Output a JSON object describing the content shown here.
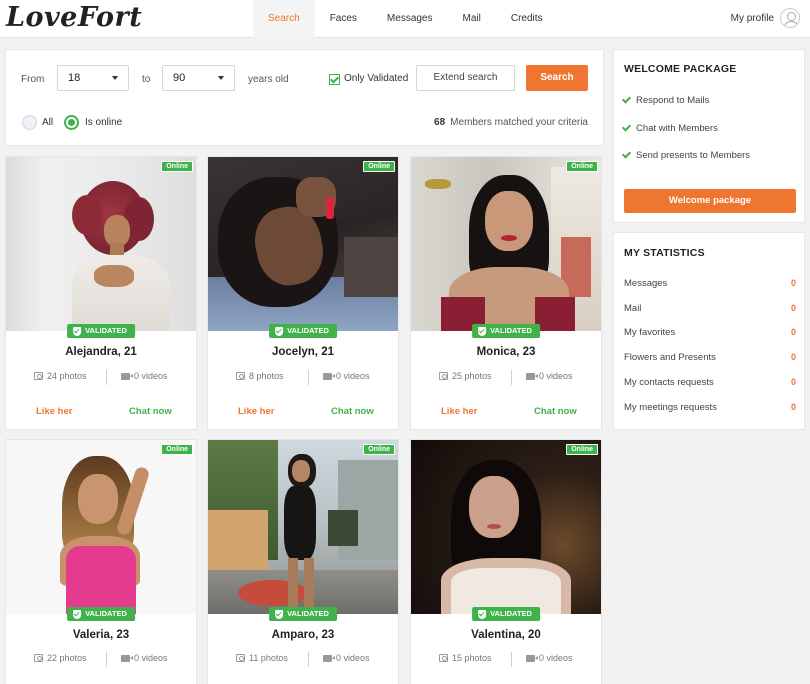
{
  "header": {
    "logo": "LoveFort",
    "nav": [
      "Search",
      "Faces",
      "Messages",
      "Mail",
      "Credits"
    ],
    "profile_label": "My profile"
  },
  "search": {
    "from_label": "From",
    "from_value": "18",
    "to_label": "to",
    "to_value": "90",
    "years_label": "years old",
    "only_validated_label": "Only Validated",
    "extend_label": "Extend search",
    "search_label": "Search",
    "all_label": "All",
    "online_label": "Is online",
    "matched_count": "68",
    "matched_text": "Members matched your criteria"
  },
  "card_labels": {
    "online": "Online",
    "validated": "VALIDATED",
    "like": "Like her",
    "chat": "Chat now"
  },
  "members": [
    {
      "name": "Alejandra, 21",
      "photos": "24 photos",
      "videos": "0 videos"
    },
    {
      "name": "Jocelyn, 21",
      "photos": "8 photos",
      "videos": "0 videos"
    },
    {
      "name": "Monica, 23",
      "photos": "25 photos",
      "videos": "0 videos"
    },
    {
      "name": "Valeria, 23",
      "photos": "22 photos",
      "videos": "0 videos"
    },
    {
      "name": "Amparo, 23",
      "photos": "11 photos",
      "videos": "0 videos"
    },
    {
      "name": "Valentina, 20",
      "photos": "15 photos",
      "videos": "0 videos"
    }
  ],
  "welcome": {
    "title": "WELCOME PACKAGE",
    "items": [
      "Respond to Mails",
      "Chat with Members",
      "Send presents to Members"
    ],
    "button": "Welcome package"
  },
  "statistics": {
    "title": "MY STATISTICS",
    "rows": [
      {
        "label": "Messages",
        "value": "0"
      },
      {
        "label": "Mail",
        "value": "0"
      },
      {
        "label": "My favorites",
        "value": "0"
      },
      {
        "label": "Flowers and Presents",
        "value": "0"
      },
      {
        "label": "My contacts requests",
        "value": "0"
      },
      {
        "label": "My meetings requests",
        "value": "0"
      }
    ]
  },
  "colors": {
    "accent": "#ee7630",
    "green": "#3fb24b"
  }
}
